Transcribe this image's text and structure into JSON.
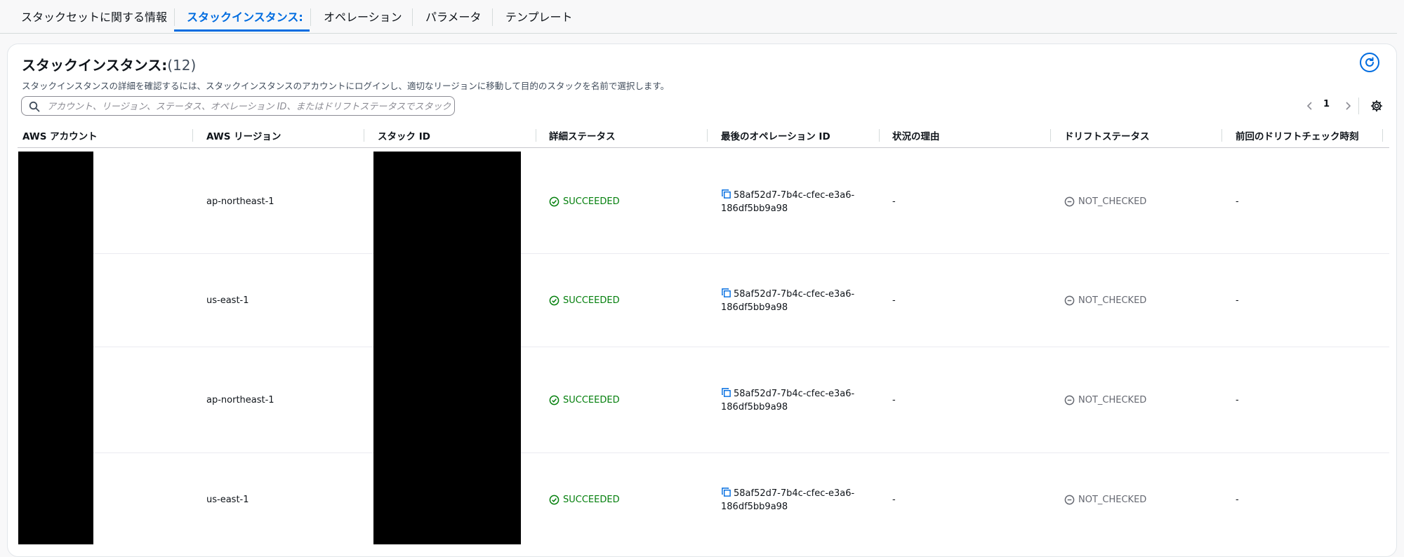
{
  "tabs": [
    {
      "label": "スタックセットに関する情報"
    },
    {
      "label": "スタックインスタンス:"
    },
    {
      "label": "オペレーション"
    },
    {
      "label": "パラメータ"
    },
    {
      "label": "テンプレート"
    }
  ],
  "panel": {
    "title": "スタックインスタンス:",
    "count": "(12)",
    "description": "スタックインスタンスの詳細を確認するには、スタックインスタンスのアカウントにログインし、適切なリージョンに移動して目的のスタックを名前で選択します。",
    "search_placeholder": "アカウント、リージョン、ステータス、オペレーション ID、またはドリフトステータスでスタックインスタンスを検索",
    "page_number": "1"
  },
  "table": {
    "columns": [
      "AWS アカウント",
      "AWS リージョン",
      "スタック ID",
      "詳細ステータス",
      "最後のオペレーション ID",
      "状況の理由",
      "ドリフトステータス",
      "前回のドリフトチェック時刻"
    ],
    "rows": [
      {
        "region": "ap-northeast-1",
        "status": "SUCCEEDED",
        "op_id_1": "58af52d7-7b4c-cfec-e3a6-",
        "op_id_2": "186df5bb9a98",
        "reason": "-",
        "drift": "NOT_CHECKED",
        "last_check": "-"
      },
      {
        "region": "us-east-1",
        "status": "SUCCEEDED",
        "op_id_1": "58af52d7-7b4c-cfec-e3a6-",
        "op_id_2": "186df5bb9a98",
        "reason": "-",
        "drift": "NOT_CHECKED",
        "last_check": "-"
      },
      {
        "region": "ap-northeast-1",
        "status": "SUCCEEDED",
        "op_id_1": "58af52d7-7b4c-cfec-e3a6-",
        "op_id_2": "186df5bb9a98",
        "reason": "-",
        "drift": "NOT_CHECKED",
        "last_check": "-"
      },
      {
        "region": "us-east-1",
        "status": "SUCCEEDED",
        "op_id_1": "58af52d7-7b4c-cfec-e3a6-",
        "op_id_2": "186df5bb9a98",
        "reason": "-",
        "drift": "NOT_CHECKED",
        "last_check": "-"
      }
    ]
  },
  "colors": {
    "accent": "#006ce0",
    "success": "#037f0c",
    "muted": "#656871"
  }
}
